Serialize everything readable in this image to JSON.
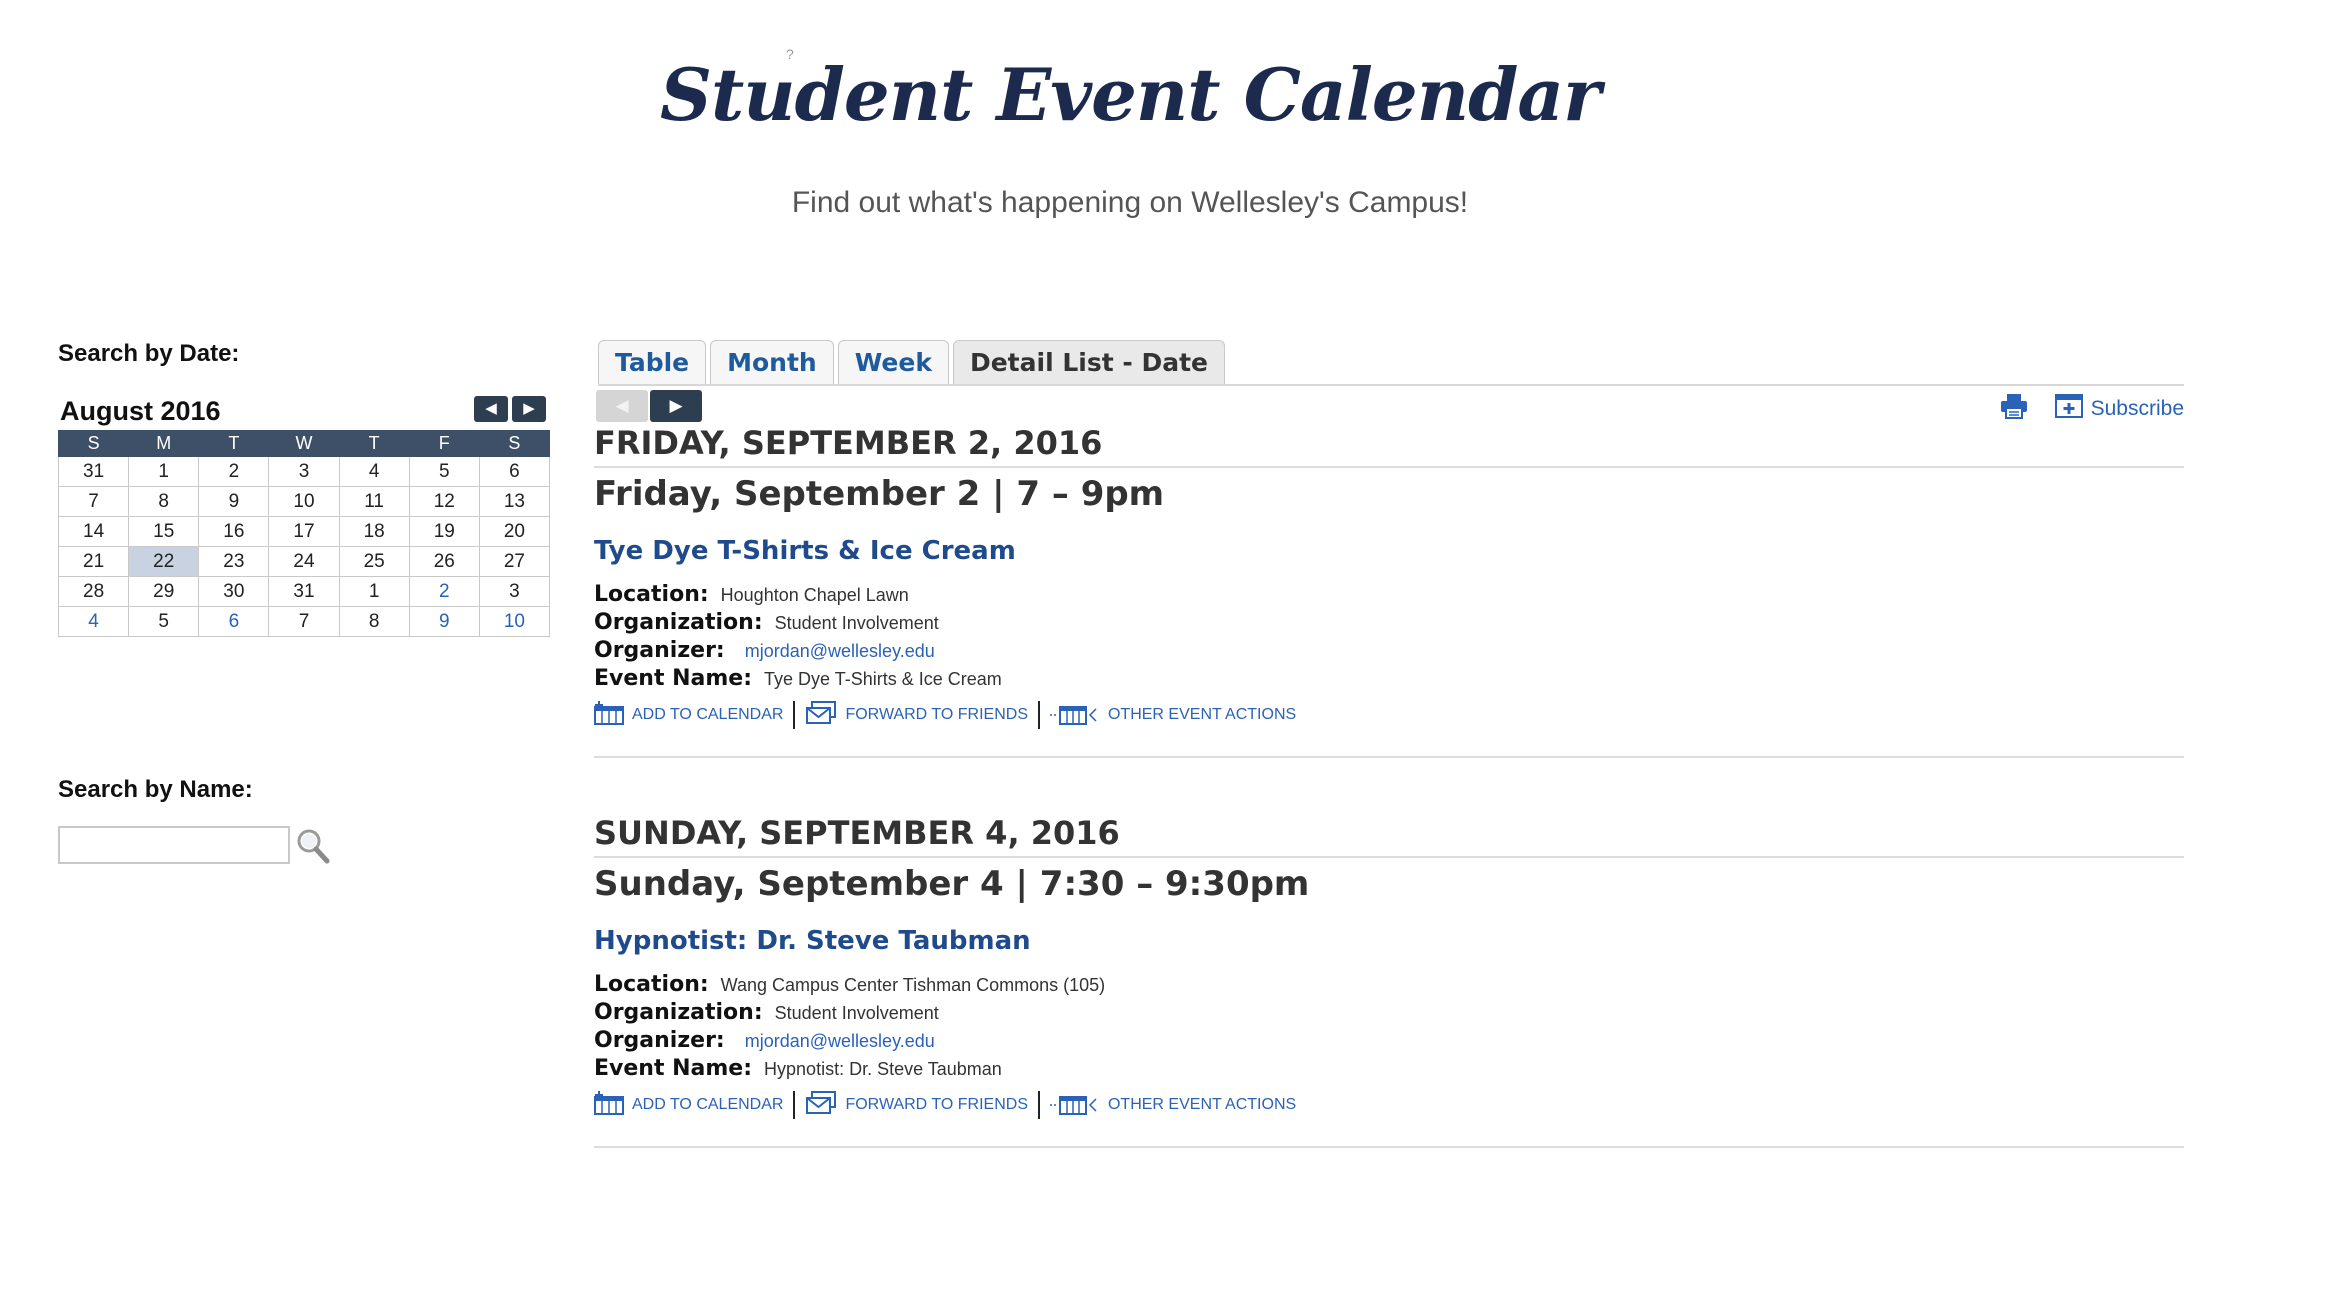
{
  "page": {
    "title": "Student Event Calendar",
    "title_mark": "?",
    "subtitle": "Find out what's happening on Wellesley's Campus!"
  },
  "sidebar": {
    "date_heading": "Search by Date:",
    "name_heading": "Search by Name:",
    "search_placeholder": "",
    "mini_calendar": {
      "month_label": "August 2016",
      "prev_label": "◀",
      "next_label": "▶",
      "weekdays": [
        "S",
        "M",
        "T",
        "W",
        "T",
        "F",
        "S"
      ],
      "weeks": [
        [
          {
            "d": "31"
          },
          {
            "d": "1"
          },
          {
            "d": "2"
          },
          {
            "d": "3"
          },
          {
            "d": "4"
          },
          {
            "d": "5"
          },
          {
            "d": "6"
          }
        ],
        [
          {
            "d": "7"
          },
          {
            "d": "8"
          },
          {
            "d": "9"
          },
          {
            "d": "10"
          },
          {
            "d": "11"
          },
          {
            "d": "12"
          },
          {
            "d": "13"
          }
        ],
        [
          {
            "d": "14"
          },
          {
            "d": "15"
          },
          {
            "d": "16"
          },
          {
            "d": "17"
          },
          {
            "d": "18"
          },
          {
            "d": "19"
          },
          {
            "d": "20"
          }
        ],
        [
          {
            "d": "21"
          },
          {
            "d": "22",
            "today": true
          },
          {
            "d": "23"
          },
          {
            "d": "24"
          },
          {
            "d": "25"
          },
          {
            "d": "26"
          },
          {
            "d": "27"
          }
        ],
        [
          {
            "d": "28"
          },
          {
            "d": "29"
          },
          {
            "d": "30"
          },
          {
            "d": "31"
          },
          {
            "d": "1"
          },
          {
            "d": "2",
            "link": true
          },
          {
            "d": "3"
          }
        ],
        [
          {
            "d": "4",
            "link": true
          },
          {
            "d": "5"
          },
          {
            "d": "6",
            "link": true
          },
          {
            "d": "7"
          },
          {
            "d": "8"
          },
          {
            "d": "9",
            "link": true
          },
          {
            "d": "10",
            "link": true
          }
        ]
      ]
    }
  },
  "tabs": [
    {
      "label": "Table",
      "active": false
    },
    {
      "label": "Month",
      "active": false
    },
    {
      "label": "Week",
      "active": false
    },
    {
      "label": "Detail List - Date",
      "active": true
    }
  ],
  "toolbar": {
    "prev_label": "◀",
    "next_label": "▶",
    "subscribe_label": "Subscribe"
  },
  "field_labels": {
    "location": "Location:",
    "organization": "Organization:",
    "organizer": "Organizer:",
    "event_name": "Event Name:"
  },
  "actions": {
    "add": "ADD TO CALENDAR",
    "forward": "FORWARD TO FRIENDS",
    "other": "OTHER EVENT ACTIONS"
  },
  "events": [
    {
      "date_header": "FRIDAY, SEPTEMBER 2, 2016",
      "time": "Friday, September 2 | 7 – 9pm",
      "name": "Tye Dye T-Shirts & Ice Cream",
      "location": "Houghton Chapel Lawn",
      "organization": "Student Involvement",
      "organizer": "mjordan@wellesley.edu",
      "event_name": "Tye Dye T-Shirts & Ice Cream"
    },
    {
      "date_header": "SUNDAY, SEPTEMBER 4, 2016",
      "time": "Sunday, September 4 | 7:30 – 9:30pm",
      "name": "Hypnotist: Dr. Steve Taubman",
      "location": "Wang Campus Center Tishman Commons (105)",
      "organization": "Student Involvement",
      "organizer": "mjordan@wellesley.edu",
      "event_name": "Hypnotist: Dr. Steve Taubman"
    }
  ],
  "colors": {
    "title": "#1c2a4d",
    "link": "#2a62b8",
    "calendar_header": "#3d5068",
    "nav_button": "#2d3e50",
    "today_highlight": "#c9d2e1"
  }
}
